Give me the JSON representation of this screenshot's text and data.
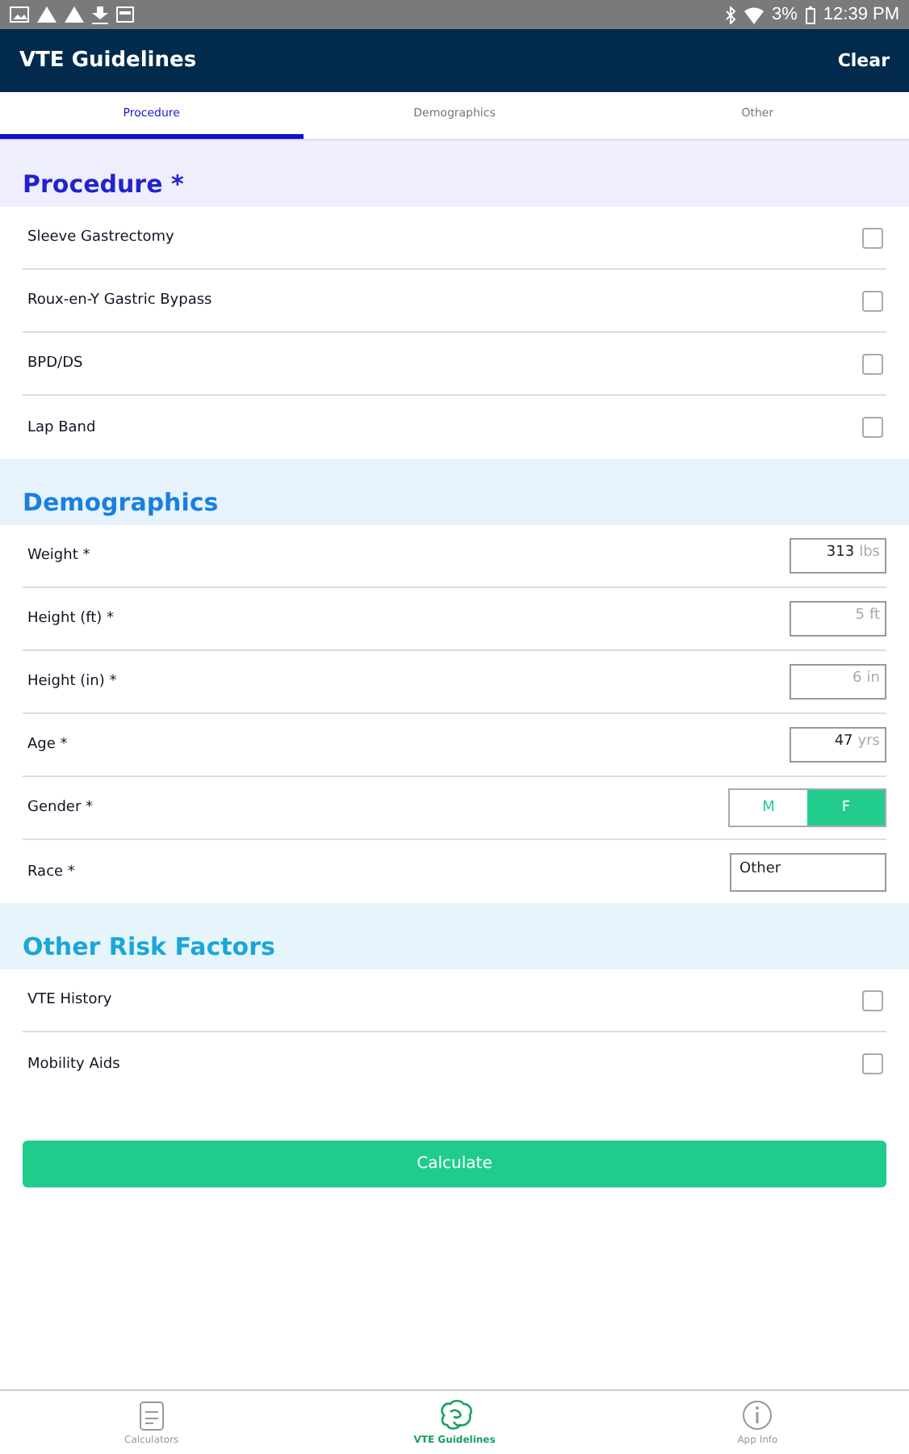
{
  "status_bar": {
    "time": "12:39 PM",
    "battery": "3%"
  },
  "header": {
    "title": "VTE Guidelines",
    "action": "Clear"
  },
  "tabs": [
    {
      "label": "Procedure",
      "selected": true
    },
    {
      "label": "Demographics",
      "selected": false
    },
    {
      "label": "Other",
      "selected": false
    }
  ],
  "sections": [
    {
      "title": "Procedure *",
      "kind": "procedure",
      "rows": [
        {
          "kind": "checkbox",
          "label": "Sleeve Gastrectomy",
          "checked": false
        },
        {
          "kind": "checkbox",
          "label": "Roux-en-Y Gastric Bypass",
          "checked": false
        },
        {
          "kind": "checkbox",
          "label": "BPD/DS",
          "checked": false
        },
        {
          "kind": "checkbox",
          "label": "Lap Band",
          "checked": false
        }
      ]
    },
    {
      "title": "Demographics",
      "kind": "demographics",
      "rows": [
        {
          "kind": "number",
          "label": "Weight *",
          "value": "313",
          "unit": "lbs"
        },
        {
          "kind": "number",
          "label": "Height (ft) *",
          "placeholder": "5",
          "unit": "ft"
        },
        {
          "kind": "number",
          "label": "Height (in) *",
          "placeholder": "6",
          "unit": "in"
        },
        {
          "kind": "number",
          "label": "Age *",
          "value": "47",
          "unit": "yrs"
        },
        {
          "kind": "toggle",
          "label": "Gender *",
          "options": [
            {
              "label": "M",
              "selected": false
            },
            {
              "label": "F",
              "selected": true
            }
          ]
        },
        {
          "kind": "select",
          "label": "Race *",
          "value": "Other"
        }
      ]
    },
    {
      "title": "Other Risk Factors",
      "kind": "other",
      "rows": [
        {
          "kind": "checkbox",
          "label": "VTE History",
          "checked": false
        },
        {
          "kind": "checkbox",
          "label": "Mobility Aids",
          "checked": false
        }
      ]
    }
  ],
  "calculate_button": "Calculate",
  "bottom_nav": [
    {
      "label": "Calculators",
      "selected": false
    },
    {
      "label": "VTE Guidelines",
      "selected": true
    },
    {
      "label": "App Info",
      "selected": false
    }
  ]
}
